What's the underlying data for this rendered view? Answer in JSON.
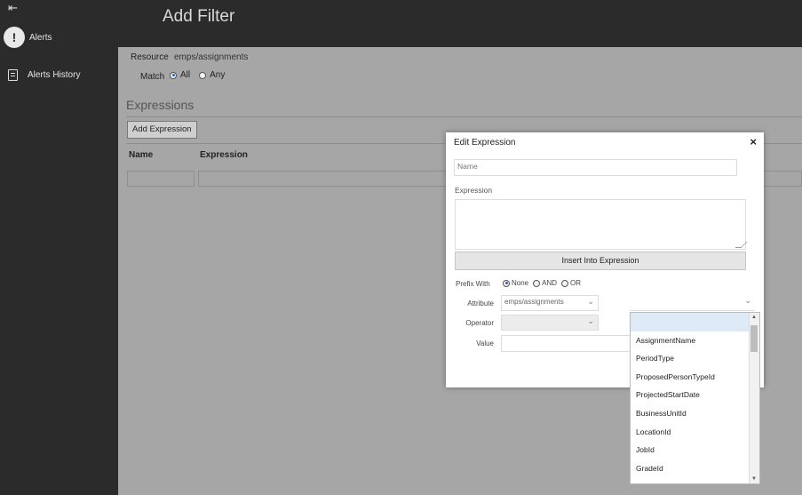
{
  "sidebar": {
    "collapse_icon": "⇤",
    "items": [
      {
        "label": "Alerts",
        "icon": "alert-circle-icon",
        "glyph": "!"
      },
      {
        "label": "Alerts History",
        "icon": "document-list-icon"
      }
    ]
  },
  "header": {
    "title": "Add Filter"
  },
  "filter": {
    "resource_label": "Resource",
    "resource_value": "emps/assignments",
    "match_label": "Match",
    "match_options": [
      "All",
      "Any"
    ],
    "match_selected": "All",
    "expressions_heading": "Expressions",
    "add_expression_label": "Add Expression",
    "columns": [
      "Name",
      "Expression"
    ]
  },
  "modal": {
    "title": "Edit Expression",
    "close_icon": "×",
    "name_placeholder": "Name",
    "expression_label": "Expression",
    "insert_button": "Insert Into Expression",
    "prefix_label": "Prefix With",
    "prefix_options": [
      "None",
      "AND",
      "OR"
    ],
    "prefix_selected": "None",
    "attribute_label": "Attribute",
    "attribute_value": "emps/assignments",
    "operator_label": "Operator",
    "value_label": "Value",
    "chevron": "⌄"
  },
  "dropdown": {
    "items": [
      "",
      "AssignmentName",
      "PeriodType",
      "ProposedPersonTypeId",
      "ProjectedStartDate",
      "BusinessUnitId",
      "LocationId",
      "JobId",
      "GradeId",
      "..."
    ]
  },
  "colors": {
    "sidebar_bg": "#2b2b2b",
    "content_bg": "#a6a6a6",
    "accent": "#2a66c9"
  }
}
